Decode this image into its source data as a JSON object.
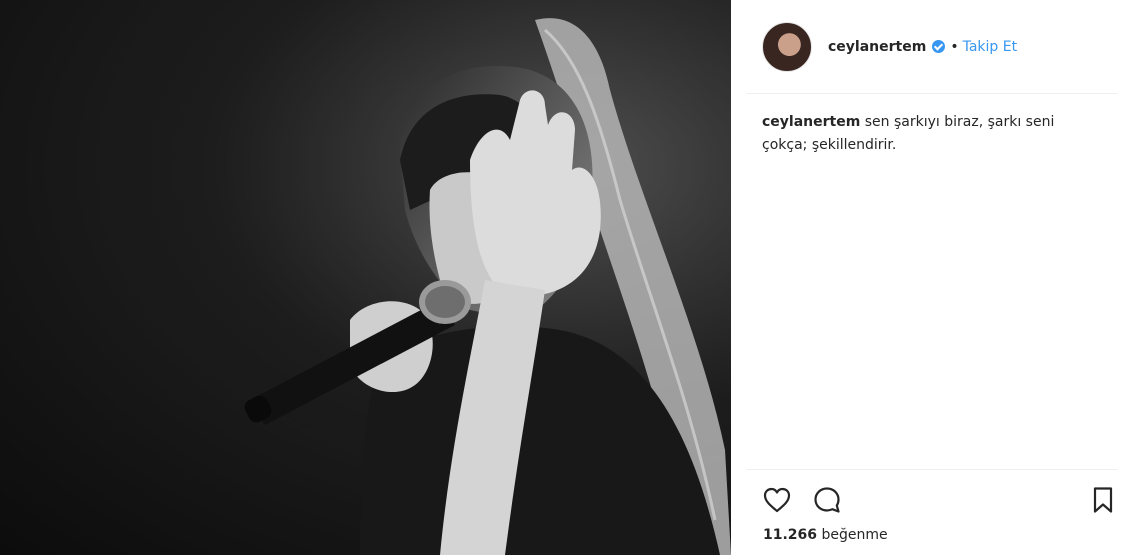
{
  "post": {
    "username": "ceylanertem",
    "dot": "•",
    "follow_label": "Takip Et",
    "caption_username": "ceylanertem",
    "caption_text": "sen şarkıyı biraz, şarkı seni çokça; şekillendirir.",
    "likes_count": "11.266",
    "likes_label": "beğenme"
  },
  "icons": {
    "verified": "verified-badge-icon",
    "like": "heart-icon",
    "comment": "comment-icon",
    "save": "bookmark-icon"
  },
  "colors": {
    "link": "#3897f0",
    "text": "#262626",
    "divider": "#efefef"
  }
}
